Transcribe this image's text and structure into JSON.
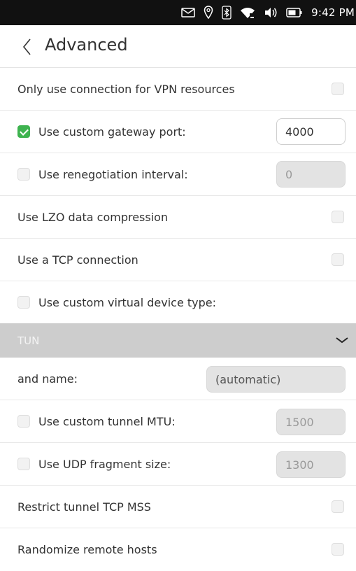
{
  "status_bar": {
    "icons": [
      "mail-icon",
      "location-icon",
      "bluetooth-icon",
      "wifi-icon",
      "volume-icon",
      "battery-icon"
    ],
    "time": "9:42 PM"
  },
  "header": {
    "title": "Advanced"
  },
  "settings": {
    "vpn_only": {
      "label": "Only use connection for VPN resources",
      "checked": false
    },
    "gateway_port": {
      "label": "Use custom gateway port:",
      "checked": true,
      "value": "4000"
    },
    "reneg_interval": {
      "label": "Use renegotiation interval:",
      "checked": false,
      "value": "0"
    },
    "lzo": {
      "label": "Use LZO data compression",
      "checked": false
    },
    "tcp": {
      "label": "Use a TCP connection",
      "checked": false
    },
    "device_type": {
      "label": "Use custom virtual device type:",
      "checked": false,
      "selected": "TUN"
    },
    "device_name": {
      "label": "and name:",
      "value": "(automatic)"
    },
    "tunnel_mtu": {
      "label": "Use custom tunnel MTU:",
      "checked": false,
      "value": "1500"
    },
    "udp_fragment": {
      "label": "Use UDP fragment size:",
      "checked": false,
      "value": "1300"
    },
    "restrict_mss": {
      "label": "Restrict tunnel TCP MSS",
      "checked": false
    },
    "randomize_hosts": {
      "label": "Randomize remote hosts",
      "checked": false
    }
  },
  "colors": {
    "accent": "#3eb34f",
    "status_bar": "#111111",
    "dropdown_bg": "#cdcdcd"
  }
}
